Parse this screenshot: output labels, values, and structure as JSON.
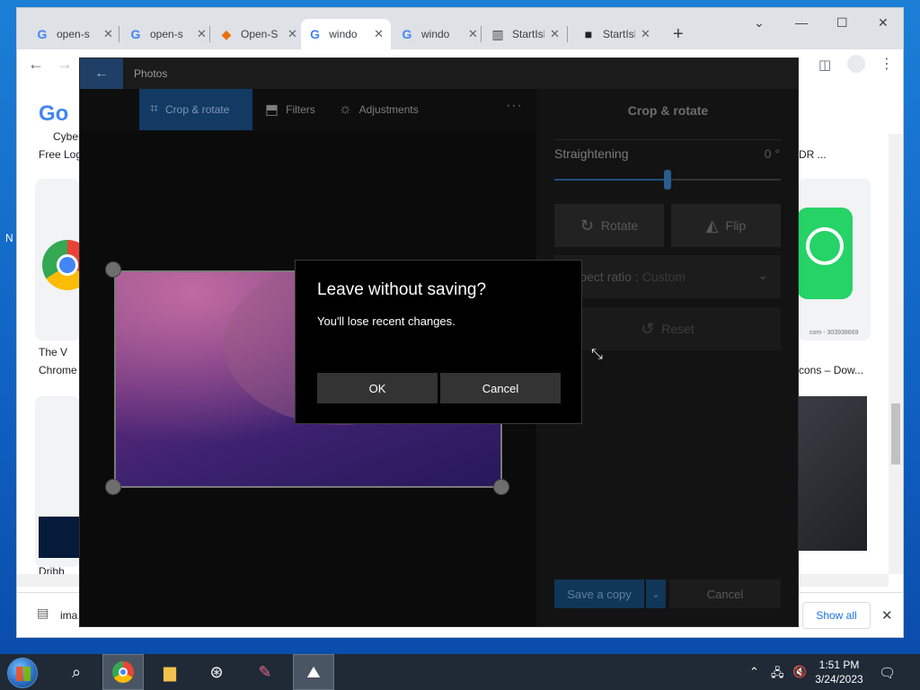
{
  "desktop": {
    "edge_label": "N"
  },
  "browser": {
    "tabs": [
      {
        "title": "open-s",
        "favicon": "G"
      },
      {
        "title": "open-s",
        "favicon": "G"
      },
      {
        "title": "Open-S",
        "favicon": "◆"
      },
      {
        "title": "windo",
        "favicon": "G"
      },
      {
        "title": "windo",
        "favicon": "G"
      },
      {
        "title": "StartIsB",
        "favicon": "▥"
      },
      {
        "title": "StartIsB",
        "favicon": "■"
      }
    ],
    "new_tab": "+",
    "window_controls": {
      "minimize": "—",
      "maximize": "☐",
      "close": "✕",
      "menu": "⌄"
    },
    "page_fragments": {
      "logo": "Go",
      "cyber": "Cyber",
      "free_log": "Free Log",
      "the_v": "The V",
      "chrome": "Chrome",
      "dribbble": "Dribb",
      "dr": "DR ...",
      "icons_dow": "cons – Dow...",
      "caption_num": "com - 303938669"
    },
    "download_bar": {
      "file_prefix": "ima",
      "show_all": "Show all",
      "close": "✕"
    }
  },
  "photos": {
    "app_title": "Photos",
    "back": "←",
    "commands": [
      {
        "label": "Crop & rotate",
        "icon": "crop-icon"
      },
      {
        "label": "Filters",
        "icon": "filters-icon"
      },
      {
        "label": "Adjustments",
        "icon": "adjustments-icon"
      }
    ],
    "more": "···",
    "panel": {
      "title": "Crop & rotate",
      "straightening_label": "Straightening",
      "straightening_value": "0 °",
      "rotate": "Rotate",
      "flip": "Flip",
      "aspect_label": "Aspect ratio :",
      "aspect_value": "Custom",
      "reset": "Reset",
      "save_copy": "Save a copy",
      "cancel": "Cancel"
    }
  },
  "dialog": {
    "title": "Leave without saving?",
    "message": "You'll lose recent changes.",
    "ok": "OK",
    "cancel": "Cancel"
  },
  "taskbar": {
    "time": "1:51 PM",
    "date": "3/24/2023"
  }
}
